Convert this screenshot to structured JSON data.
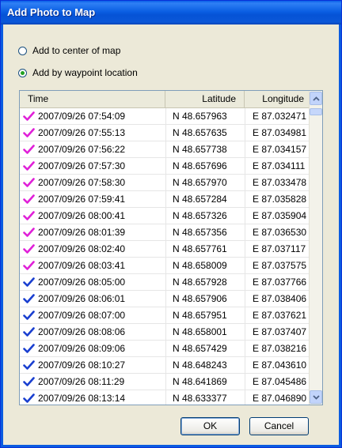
{
  "window": {
    "title": "Add Photo to Map"
  },
  "options": [
    {
      "label": "Add to center of map",
      "checked": false
    },
    {
      "label": "Add by waypoint location",
      "checked": true
    }
  ],
  "columns": {
    "time": "Time",
    "latitude": "Latitude",
    "longitude": "Longitude"
  },
  "rows": [
    {
      "time": "2007/09/26 07:54:09",
      "lat": "N 48.657963",
      "lon": "E 87.032471",
      "status": "checked-pink"
    },
    {
      "time": "2007/09/26 07:55:13",
      "lat": "N 48.657635",
      "lon": "E 87.034981",
      "status": "checked-pink"
    },
    {
      "time": "2007/09/26 07:56:22",
      "lat": "N 48.657738",
      "lon": "E 87.034157",
      "status": "checked-pink"
    },
    {
      "time": "2007/09/26 07:57:30",
      "lat": "N 48.657696",
      "lon": "E 87.034111",
      "status": "checked-pink"
    },
    {
      "time": "2007/09/26 07:58:30",
      "lat": "N 48.657970",
      "lon": "E 87.033478",
      "status": "checked-pink"
    },
    {
      "time": "2007/09/26 07:59:41",
      "lat": "N 48.657284",
      "lon": "E 87.035828",
      "status": "checked-pink"
    },
    {
      "time": "2007/09/26 08:00:41",
      "lat": "N 48.657326",
      "lon": "E 87.035904",
      "status": "checked-pink"
    },
    {
      "time": "2007/09/26 08:01:39",
      "lat": "N 48.657356",
      "lon": "E 87.036530",
      "status": "checked-pink"
    },
    {
      "time": "2007/09/26 08:02:40",
      "lat": "N 48.657761",
      "lon": "E 87.037117",
      "status": "checked-pink"
    },
    {
      "time": "2007/09/26 08:03:41",
      "lat": "N 48.658009",
      "lon": "E 87.037575",
      "status": "checked-pink"
    },
    {
      "time": "2007/09/26 08:05:00",
      "lat": "N 48.657928",
      "lon": "E 87.037766",
      "status": "checked-blue"
    },
    {
      "time": "2007/09/26 08:06:01",
      "lat": "N 48.657906",
      "lon": "E 87.038406",
      "status": "checked-blue"
    },
    {
      "time": "2007/09/26 08:07:00",
      "lat": "N 48.657951",
      "lon": "E 87.037621",
      "status": "checked-blue"
    },
    {
      "time": "2007/09/26 08:08:06",
      "lat": "N 48.658001",
      "lon": "E 87.037407",
      "status": "checked-blue"
    },
    {
      "time": "2007/09/26 08:09:06",
      "lat": "N 48.657429",
      "lon": "E 87.038216",
      "status": "checked-blue"
    },
    {
      "time": "2007/09/26 08:10:27",
      "lat": "N 48.648243",
      "lon": "E 87.043610",
      "status": "checked-blue"
    },
    {
      "time": "2007/09/26 08:11:29",
      "lat": "N 48.641869",
      "lon": "E 87.045486",
      "status": "checked-blue"
    },
    {
      "time": "2007/09/26 08:13:14",
      "lat": "N 48.633377",
      "lon": "E 87.046890",
      "status": "checked-blue"
    }
  ],
  "icons": {
    "check": "check-icon",
    "scroll_up": "chevron-up-icon",
    "scroll_down": "chevron-down-icon"
  },
  "colors": {
    "check_pink": "#e020d8",
    "check_blue": "#1a3fd0",
    "title_bar": "#0a5ee8"
  },
  "buttons": {
    "ok": "OK",
    "cancel": "Cancel"
  }
}
